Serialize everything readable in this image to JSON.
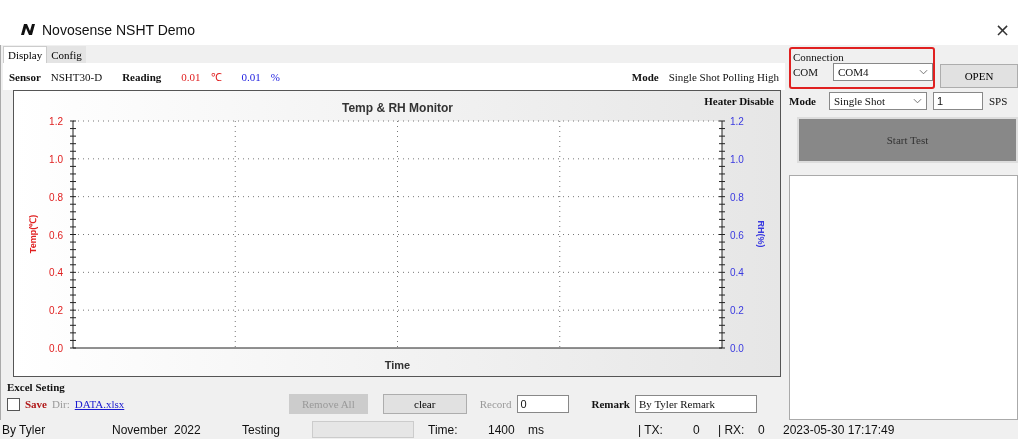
{
  "window": {
    "title": "Novosense NSHT Demo",
    "close": "×"
  },
  "tabs": [
    {
      "label": "Display",
      "selected": true
    },
    {
      "label": "Config",
      "selected": false
    }
  ],
  "readout": {
    "sensor_label": "Sensor",
    "sensor": "NSHT30-D",
    "reading_label": "Reading",
    "temp": "0.01",
    "temp_unit": "℃",
    "rh": "0.01",
    "rh_unit": "%",
    "mode_label": "Mode",
    "mode": "Single Shot Polling High"
  },
  "chart": {
    "title": "Temp & RH Monitor",
    "heater": "Heater Disable",
    "xlabel": "Time",
    "ylabel_left": "Temp(℃)",
    "ylabel_right": "RH(%)",
    "left_ticks": [
      "1.2",
      "1.0",
      "0.8",
      "0.6",
      "0.4",
      "0.2",
      "0.0"
    ],
    "right_ticks": [
      "1.2",
      "1.0",
      "0.8",
      "0.6",
      "0.4",
      "0.2",
      "0.0"
    ]
  },
  "excel": {
    "title": "Excel Seting",
    "save_checked": false,
    "save_label": "Save",
    "dir_label": "Dir:",
    "file": "DATA.xlsx",
    "remove_all": "Remove All",
    "remove_all_disabled": true,
    "clear": "clear",
    "record_label": "Record",
    "record_disabled": true,
    "record": "0",
    "remark_label": "Remark",
    "remark": "By Tyler Remark"
  },
  "connection": {
    "title": "Connection",
    "com_label": "COM",
    "com": "COM4",
    "open": "OPEN",
    "mode_label": "Mode",
    "mode": "Single Shot",
    "rate": "1",
    "rate_unit": "SPS",
    "start": "Start Test"
  },
  "status_bar": [
    {
      "kind": "text",
      "text": "By Tyler"
    },
    {
      "kind": "text",
      "text": "November  2022"
    },
    {
      "kind": "text",
      "text": "Testing"
    },
    {
      "kind": "progress"
    },
    {
      "kind": "text",
      "text": "Time:"
    },
    {
      "kind": "text",
      "text": "1400"
    },
    {
      "kind": "text",
      "text": "ms"
    },
    {
      "kind": "text",
      "text": "| TX:"
    },
    {
      "kind": "text",
      "text": "0"
    },
    {
      "kind": "text",
      "text": "| RX:"
    },
    {
      "kind": "text",
      "text": "0"
    },
    {
      "kind": "text",
      "text": "2023-05-30 17:17:49"
    }
  ]
}
